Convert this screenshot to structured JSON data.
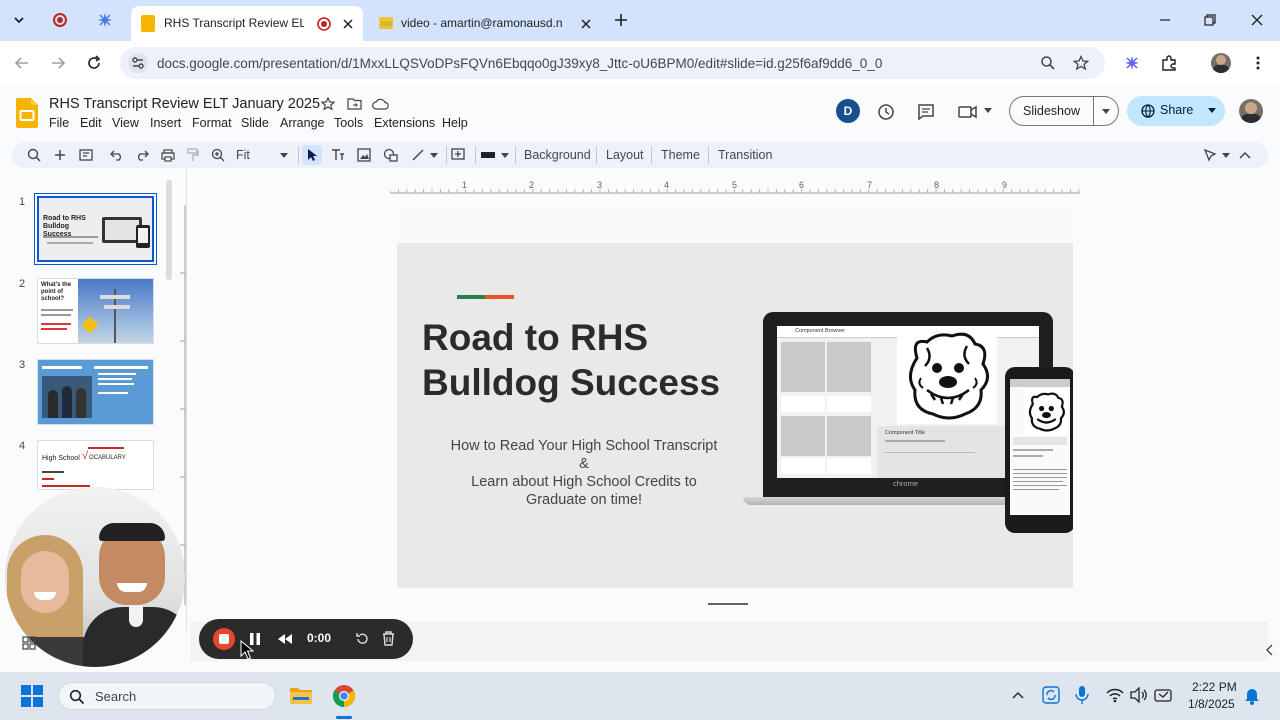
{
  "browser": {
    "tabs": [
      {
        "title": "RHS Transcript Review ELT",
        "active": true
      },
      {
        "title": "video - amartin@ramonausd.n",
        "active": false
      }
    ],
    "url": "docs.google.com/presentation/d/1MxxLLQSVoDPsFQVn6Ebqqo0gJ39xy8_Jttc-oU6BPM0/edit#slide=id.g25f6af9dd6_0_0"
  },
  "app": {
    "doc_title": "RHS Transcript Review ELT January 2025",
    "menu": [
      "File",
      "Edit",
      "View",
      "Insert",
      "Format",
      "Slide",
      "Arrange",
      "Tools",
      "Extensions",
      "Help"
    ],
    "account_initial": "D",
    "slideshow_label": "Slideshow",
    "share_label": "Share"
  },
  "editbar": {
    "zoom": "Fit",
    "buttons": [
      "Background",
      "Layout",
      "Theme",
      "Transition"
    ]
  },
  "ruler": {
    "marks": [
      "1",
      "2",
      "3",
      "4",
      "5",
      "6",
      "7",
      "8",
      "9"
    ]
  },
  "filmstrip": {
    "numbers": [
      "1",
      "2",
      "3",
      "4"
    ],
    "thumb1": {
      "title": "Road to RHS Bulldog Success"
    },
    "thumb2": {
      "title": "What's the point of school?"
    },
    "thumb4": {
      "title": "High School",
      "vocab": "OCABULARY"
    }
  },
  "slide": {
    "title_line1": "Road to RHS",
    "title_line2": "Bulldog Success",
    "sub_line1": "How to Read Your High School Transcript",
    "sub_line2": "&",
    "sub_line3": "Learn about High School Credits to",
    "sub_line4": "Graduate on time!",
    "laptop_brand": "chrome",
    "mock_header": "Component Browser",
    "mock_title": "Component Title"
  },
  "recorder": {
    "time": "0:00"
  },
  "taskbar": {
    "search_placeholder": "Search",
    "time": "2:22 PM",
    "date": "1/8/2025"
  },
  "colors": {
    "accent_line_green": "#2e7d4f",
    "accent_line_orange": "#e8542a",
    "record_red": "#e8472e"
  }
}
